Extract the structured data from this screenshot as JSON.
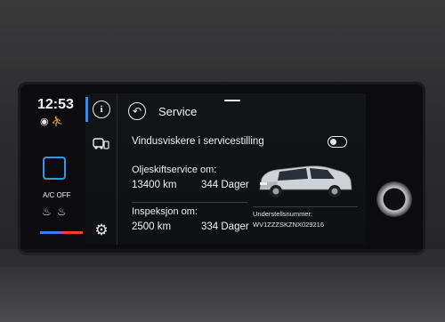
{
  "status": {
    "time": "12:53",
    "icons": [
      "location-icon",
      "person-icon"
    ]
  },
  "climate": {
    "ac_label": "A/C OFF",
    "icons": [
      "seat-heat-left-icon",
      "seat-heat-right-icon"
    ],
    "colors": {
      "cold": "#3c7dff",
      "hot": "#ff3b3b"
    }
  },
  "nav": {
    "items": [
      "info-icon",
      "car-service-icon",
      "gear-icon"
    ],
    "accent": "#2d8cf5"
  },
  "header": {
    "title": "Service"
  },
  "wipers": {
    "label": "Vindusviskere i servicestilling",
    "toggle_on": false
  },
  "oil": {
    "title": "Oljeskiftservice om:",
    "km": "13400 km",
    "days": "344 Dager"
  },
  "inspection": {
    "title": "Inspeksjon om:",
    "km": "2500 km",
    "days": "334 Dager"
  },
  "chassis": {
    "label": "Understellsnummer:",
    "value": "WV1ZZZSKZNX029216"
  }
}
